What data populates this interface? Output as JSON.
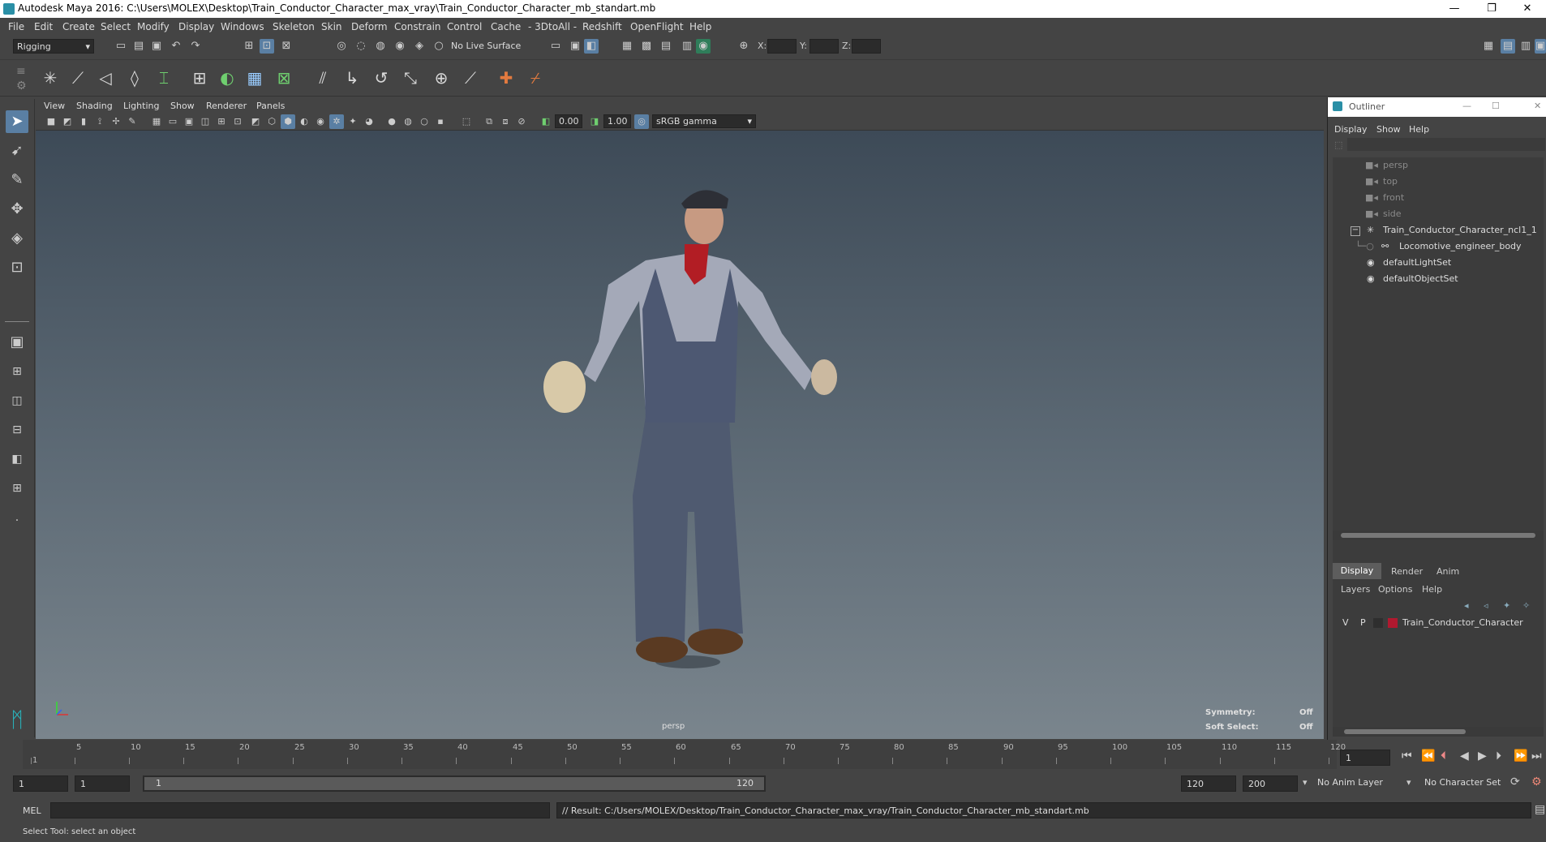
{
  "window": {
    "title": "Autodesk Maya 2016: C:\\Users\\MOLEX\\Desktop\\Train_Conductor_Character_max_vray\\Train_Conductor_Character_mb_standart.mb",
    "minimize": "—",
    "restore": "❐",
    "close": "✕"
  },
  "menubar": [
    "File",
    "Edit",
    "Create",
    "Select",
    "Modify",
    "Display",
    "Windows",
    "Skeleton",
    "Skin",
    "Deform",
    "Constrain",
    "Control",
    "Cache",
    "- 3DtoAll -",
    "Redshift",
    "OpenFlight",
    "Help"
  ],
  "statusline": {
    "mode": "Rigging",
    "live_surface": "No Live Surface",
    "x_label": "X:",
    "y_label": "Y:",
    "z_label": "Z:"
  },
  "panel": {
    "menus": [
      "View",
      "Shading",
      "Lighting",
      "Show",
      "Renderer",
      "Panels"
    ],
    "exposure": "0.00",
    "gamma": "1.00",
    "color_space": "sRGB gamma",
    "camera_label": "persp",
    "symmetry_label": "Symmetry:",
    "symmetry_value": "Off",
    "soft_select_label": "Soft Select:",
    "soft_select_value": "Off"
  },
  "outliner": {
    "title": "Outliner",
    "menus": [
      "Display",
      "Show",
      "Help"
    ],
    "items": [
      {
        "label": "persp",
        "icon": "camera-icon",
        "dim": true
      },
      {
        "label": "top",
        "icon": "camera-icon",
        "dim": true
      },
      {
        "label": "front",
        "icon": "camera-icon",
        "dim": true
      },
      {
        "label": "side",
        "icon": "camera-icon",
        "dim": true
      },
      {
        "label": "Train_Conductor_Character_ncl1_1",
        "icon": "joint-icon",
        "dim": false
      },
      {
        "label": "Locomotive_engineer_body",
        "icon": "mesh-icon",
        "dim": false
      },
      {
        "label": "defaultLightSet",
        "icon": "set-icon",
        "dim": false
      },
      {
        "label": "defaultObjectSet",
        "icon": "set-icon",
        "dim": false
      }
    ]
  },
  "layers": {
    "tabs": [
      "Display",
      "Render",
      "Anim"
    ],
    "menus": [
      "Layers",
      "Options",
      "Help"
    ],
    "layer": {
      "v": "V",
      "p": "P",
      "name": "Train_Conductor_Character",
      "color": "#b0192f"
    }
  },
  "timeline": {
    "ticks": [
      "1",
      "5",
      "10",
      "15",
      "20",
      "25",
      "30",
      "35",
      "40",
      "45",
      "50",
      "55",
      "60",
      "65",
      "70",
      "75",
      "80",
      "85",
      "90",
      "95",
      "100",
      "105",
      "110",
      "115",
      "120"
    ],
    "current_frame": "1"
  },
  "range": {
    "start": "1",
    "anim_start": "1",
    "range_start_label": "1",
    "range_end_label": "120",
    "end": "120",
    "anim_end": "200",
    "anim_layer": "No Anim Layer",
    "character_set": "No Character Set"
  },
  "cmdline": {
    "language": "MEL",
    "result": "// Result: C:/Users/MOLEX/Desktop/Train_Conductor_Character_max_vray/Train_Conductor_Character_mb_standart.mb"
  },
  "helpline": {
    "text": "Select Tool: select an object"
  }
}
